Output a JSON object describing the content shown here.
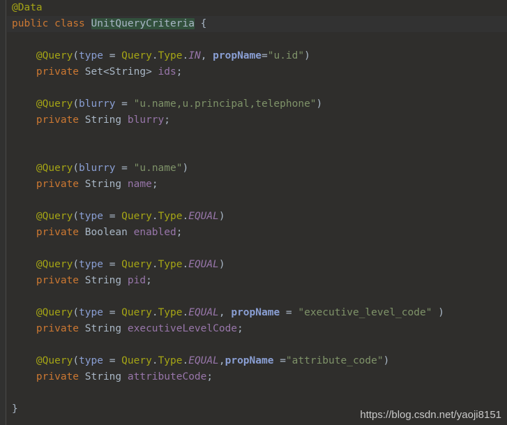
{
  "editor": {
    "language": "java",
    "file_name": "UnitQueryCriteria.java",
    "background_color": "#2f2e2c",
    "gutter_color": "#313130",
    "caret_line_color": "#323232",
    "usage_highlight_color": "#32503c",
    "default_text_color": "#a9b7c6",
    "top_partial_comment": "*/"
  },
  "palette": {
    "keyword": "#cc7832",
    "annotation": "#a5a515",
    "string": "#7f9369",
    "field": "#9876aa",
    "static_constant": "#9876aa",
    "annotation_param": "#8a9fd4",
    "type": "#a9b7c6",
    "comment": "#5f8c5a"
  },
  "watermark": {
    "text": "https://blog.csdn.net/yaoji8151",
    "color": "#c9c9c9"
  },
  "lines": [
    {
      "n": 1,
      "caret": false,
      "tokens": [
        {
          "c": "annotation",
          "t": "@Data"
        }
      ]
    },
    {
      "n": 2,
      "caret": true,
      "tokens": [
        {
          "c": "keyword",
          "t": "public"
        },
        {
          "c": "default",
          "t": " "
        },
        {
          "c": "keyword",
          "t": "class"
        },
        {
          "c": "default",
          "t": " "
        },
        {
          "c": "classname",
          "t": "UnitQueryCriteria",
          "hl": true
        },
        {
          "c": "default",
          "t": " "
        },
        {
          "c": "punct",
          "t": "{"
        }
      ]
    },
    {
      "n": 3,
      "caret": false,
      "tokens": []
    },
    {
      "n": 4,
      "caret": false,
      "tokens": [
        {
          "c": "default",
          "t": "    "
        },
        {
          "c": "annotation",
          "t": "@Query"
        },
        {
          "c": "punct",
          "t": "("
        },
        {
          "c": "param",
          "t": "type"
        },
        {
          "c": "default",
          "t": " "
        },
        {
          "c": "punct",
          "t": "="
        },
        {
          "c": "default",
          "t": " "
        },
        {
          "c": "annotation",
          "t": "Query"
        },
        {
          "c": "punct",
          "t": "."
        },
        {
          "c": "annotation",
          "t": "Type"
        },
        {
          "c": "punct",
          "t": "."
        },
        {
          "c": "static",
          "t": "IN"
        },
        {
          "c": "punct",
          "t": ","
        },
        {
          "c": "default",
          "t": " "
        },
        {
          "c": "param-b",
          "t": "propName"
        },
        {
          "c": "punct",
          "t": "="
        },
        {
          "c": "string",
          "t": "\"u.id\""
        },
        {
          "c": "punct",
          "t": ")"
        }
      ]
    },
    {
      "n": 5,
      "caret": false,
      "tokens": [
        {
          "c": "default",
          "t": "    "
        },
        {
          "c": "keyword",
          "t": "private"
        },
        {
          "c": "default",
          "t": " "
        },
        {
          "c": "type",
          "t": "Set<String>"
        },
        {
          "c": "default",
          "t": " "
        },
        {
          "c": "field",
          "t": "ids"
        },
        {
          "c": "punct",
          "t": ";"
        }
      ]
    },
    {
      "n": 6,
      "caret": false,
      "tokens": []
    },
    {
      "n": 7,
      "caret": false,
      "tokens": [
        {
          "c": "default",
          "t": "    "
        },
        {
          "c": "annotation",
          "t": "@Query"
        },
        {
          "c": "punct",
          "t": "("
        },
        {
          "c": "param",
          "t": "blurry"
        },
        {
          "c": "default",
          "t": " "
        },
        {
          "c": "punct",
          "t": "="
        },
        {
          "c": "default",
          "t": " "
        },
        {
          "c": "string",
          "t": "\"u.name,u.principal,telephone\""
        },
        {
          "c": "punct",
          "t": ")"
        }
      ]
    },
    {
      "n": 8,
      "caret": false,
      "tokens": [
        {
          "c": "default",
          "t": "    "
        },
        {
          "c": "keyword",
          "t": "private"
        },
        {
          "c": "default",
          "t": " "
        },
        {
          "c": "type",
          "t": "String"
        },
        {
          "c": "default",
          "t": " "
        },
        {
          "c": "field",
          "t": "blurry"
        },
        {
          "c": "punct",
          "t": ";"
        }
      ]
    },
    {
      "n": 9,
      "caret": false,
      "tokens": []
    },
    {
      "n": 10,
      "caret": false,
      "tokens": []
    },
    {
      "n": 11,
      "caret": false,
      "tokens": [
        {
          "c": "default",
          "t": "    "
        },
        {
          "c": "annotation",
          "t": "@Query"
        },
        {
          "c": "punct",
          "t": "("
        },
        {
          "c": "param",
          "t": "blurry"
        },
        {
          "c": "default",
          "t": " "
        },
        {
          "c": "punct",
          "t": "="
        },
        {
          "c": "default",
          "t": " "
        },
        {
          "c": "string",
          "t": "\"u.name\""
        },
        {
          "c": "punct",
          "t": ")"
        }
      ]
    },
    {
      "n": 12,
      "caret": false,
      "tokens": [
        {
          "c": "default",
          "t": "    "
        },
        {
          "c": "keyword",
          "t": "private"
        },
        {
          "c": "default",
          "t": " "
        },
        {
          "c": "type",
          "t": "String"
        },
        {
          "c": "default",
          "t": " "
        },
        {
          "c": "field",
          "t": "name"
        },
        {
          "c": "punct",
          "t": ";"
        }
      ]
    },
    {
      "n": 13,
      "caret": false,
      "tokens": []
    },
    {
      "n": 14,
      "caret": false,
      "tokens": [
        {
          "c": "default",
          "t": "    "
        },
        {
          "c": "annotation",
          "t": "@Query"
        },
        {
          "c": "punct",
          "t": "("
        },
        {
          "c": "param",
          "t": "type"
        },
        {
          "c": "default",
          "t": " "
        },
        {
          "c": "punct",
          "t": "="
        },
        {
          "c": "default",
          "t": " "
        },
        {
          "c": "annotation",
          "t": "Query"
        },
        {
          "c": "punct",
          "t": "."
        },
        {
          "c": "annotation",
          "t": "Type"
        },
        {
          "c": "punct",
          "t": "."
        },
        {
          "c": "static",
          "t": "EQUAL"
        },
        {
          "c": "punct",
          "t": ")"
        }
      ]
    },
    {
      "n": 15,
      "caret": false,
      "tokens": [
        {
          "c": "default",
          "t": "    "
        },
        {
          "c": "keyword",
          "t": "private"
        },
        {
          "c": "default",
          "t": " "
        },
        {
          "c": "type",
          "t": "Boolean"
        },
        {
          "c": "default",
          "t": " "
        },
        {
          "c": "field",
          "t": "enabled"
        },
        {
          "c": "punct",
          "t": ";"
        }
      ]
    },
    {
      "n": 16,
      "caret": false,
      "tokens": []
    },
    {
      "n": 17,
      "caret": false,
      "tokens": [
        {
          "c": "default",
          "t": "    "
        },
        {
          "c": "annotation",
          "t": "@Query"
        },
        {
          "c": "punct",
          "t": "("
        },
        {
          "c": "param",
          "t": "type"
        },
        {
          "c": "default",
          "t": " "
        },
        {
          "c": "punct",
          "t": "="
        },
        {
          "c": "default",
          "t": " "
        },
        {
          "c": "annotation",
          "t": "Query"
        },
        {
          "c": "punct",
          "t": "."
        },
        {
          "c": "annotation",
          "t": "Type"
        },
        {
          "c": "punct",
          "t": "."
        },
        {
          "c": "static",
          "t": "EQUAL"
        },
        {
          "c": "punct",
          "t": ")"
        }
      ]
    },
    {
      "n": 18,
      "caret": false,
      "tokens": [
        {
          "c": "default",
          "t": "    "
        },
        {
          "c": "keyword",
          "t": "private"
        },
        {
          "c": "default",
          "t": " "
        },
        {
          "c": "type",
          "t": "String"
        },
        {
          "c": "default",
          "t": " "
        },
        {
          "c": "field",
          "t": "pid"
        },
        {
          "c": "punct",
          "t": ";"
        }
      ]
    },
    {
      "n": 19,
      "caret": false,
      "tokens": []
    },
    {
      "n": 20,
      "caret": false,
      "tokens": [
        {
          "c": "default",
          "t": "    "
        },
        {
          "c": "annotation",
          "t": "@Query"
        },
        {
          "c": "punct",
          "t": "("
        },
        {
          "c": "param",
          "t": "type"
        },
        {
          "c": "default",
          "t": " "
        },
        {
          "c": "punct",
          "t": "="
        },
        {
          "c": "default",
          "t": " "
        },
        {
          "c": "annotation",
          "t": "Query"
        },
        {
          "c": "punct",
          "t": "."
        },
        {
          "c": "annotation",
          "t": "Type"
        },
        {
          "c": "punct",
          "t": "."
        },
        {
          "c": "static",
          "t": "EQUAL"
        },
        {
          "c": "punct",
          "t": ","
        },
        {
          "c": "default",
          "t": " "
        },
        {
          "c": "param-b",
          "t": "propName"
        },
        {
          "c": "default",
          "t": " "
        },
        {
          "c": "punct",
          "t": "="
        },
        {
          "c": "default",
          "t": " "
        },
        {
          "c": "string",
          "t": "\"executive_level_code\""
        },
        {
          "c": "default",
          "t": " "
        },
        {
          "c": "punct",
          "t": ")"
        }
      ]
    },
    {
      "n": 21,
      "caret": false,
      "tokens": [
        {
          "c": "default",
          "t": "    "
        },
        {
          "c": "keyword",
          "t": "private"
        },
        {
          "c": "default",
          "t": " "
        },
        {
          "c": "type",
          "t": "String"
        },
        {
          "c": "default",
          "t": " "
        },
        {
          "c": "field",
          "t": "executiveLevelCode"
        },
        {
          "c": "punct",
          "t": ";"
        }
      ]
    },
    {
      "n": 22,
      "caret": false,
      "tokens": []
    },
    {
      "n": 23,
      "caret": false,
      "tokens": [
        {
          "c": "default",
          "t": "    "
        },
        {
          "c": "annotation",
          "t": "@Query"
        },
        {
          "c": "punct",
          "t": "("
        },
        {
          "c": "param",
          "t": "type"
        },
        {
          "c": "default",
          "t": " "
        },
        {
          "c": "punct",
          "t": "="
        },
        {
          "c": "default",
          "t": " "
        },
        {
          "c": "annotation",
          "t": "Query"
        },
        {
          "c": "punct",
          "t": "."
        },
        {
          "c": "annotation",
          "t": "Type"
        },
        {
          "c": "punct",
          "t": "."
        },
        {
          "c": "static",
          "t": "EQUAL"
        },
        {
          "c": "punct",
          "t": ","
        },
        {
          "c": "param-b",
          "t": "propName"
        },
        {
          "c": "default",
          "t": " "
        },
        {
          "c": "punct",
          "t": "="
        },
        {
          "c": "string",
          "t": "\"attribute_code\""
        },
        {
          "c": "punct",
          "t": ")"
        }
      ]
    },
    {
      "n": 24,
      "caret": false,
      "tokens": [
        {
          "c": "default",
          "t": "    "
        },
        {
          "c": "keyword",
          "t": "private"
        },
        {
          "c": "default",
          "t": " "
        },
        {
          "c": "type",
          "t": "String"
        },
        {
          "c": "default",
          "t": " "
        },
        {
          "c": "field",
          "t": "attributeCode"
        },
        {
          "c": "punct",
          "t": ";"
        }
      ]
    },
    {
      "n": 25,
      "caret": false,
      "tokens": []
    },
    {
      "n": 26,
      "caret": false,
      "tokens": [
        {
          "c": "punct",
          "t": "}"
        }
      ]
    }
  ]
}
